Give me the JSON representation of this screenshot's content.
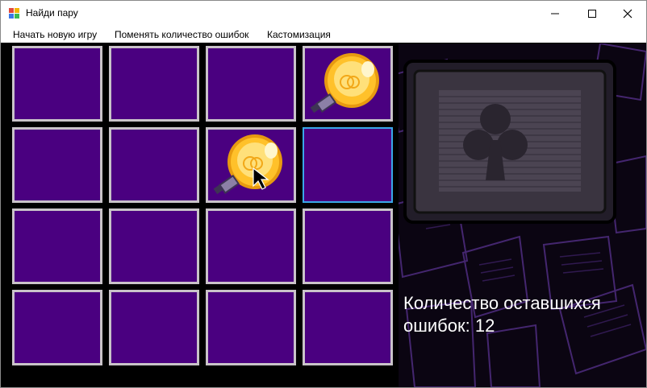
{
  "window": {
    "title": "Найди пару",
    "controls": {
      "minimize": "—",
      "maximize": "☐",
      "close": "✕"
    }
  },
  "menu": {
    "items": [
      {
        "label": "Начать новую игру"
      },
      {
        "label": "Поменять количество ошибок"
      },
      {
        "label": "Кастомизация"
      }
    ]
  },
  "board": {
    "rows": 4,
    "cols": 4,
    "card_back_color": "#4a0080",
    "cards": [
      {
        "state": "hidden"
      },
      {
        "state": "hidden"
      },
      {
        "state": "hidden"
      },
      {
        "state": "revealed",
        "icon": "lightbulb-icon"
      },
      {
        "state": "hidden"
      },
      {
        "state": "hidden"
      },
      {
        "state": "revealed",
        "icon": "lightbulb-icon"
      },
      {
        "state": "hidden",
        "focused": true
      },
      {
        "state": "hidden"
      },
      {
        "state": "hidden"
      },
      {
        "state": "hidden"
      },
      {
        "state": "hidden"
      },
      {
        "state": "hidden"
      },
      {
        "state": "hidden"
      },
      {
        "state": "hidden"
      },
      {
        "state": "hidden"
      }
    ]
  },
  "status": {
    "errors_label": "Количество оставшихся ошибок: 12",
    "errors_remaining": 12
  },
  "colors": {
    "accent_purple": "#4a0080",
    "focus_blue": "#3aa7e8",
    "bulb_yellow": "#ffcc22"
  },
  "background_art": "club-monitor-art"
}
